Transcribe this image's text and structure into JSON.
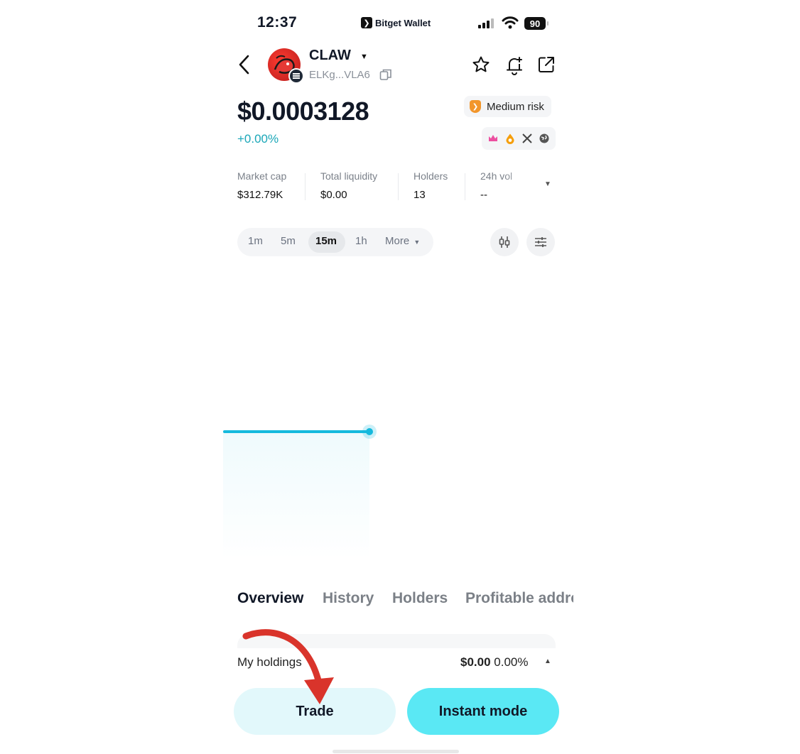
{
  "status_bar": {
    "time": "12:37",
    "app_name": "Bitget Wallet",
    "battery": "90"
  },
  "token": {
    "symbol": "CLAW",
    "address": "ELKg...VLA6",
    "price": "$0.0003128",
    "change": "+0.00%",
    "risk_label": "Medium risk",
    "change_color": "#1aa7b8"
  },
  "stats": [
    {
      "label": "Market cap",
      "value": "$312.79K"
    },
    {
      "label": "Total liquidity",
      "value": "$0.00"
    },
    {
      "label": "Holders",
      "value": "13"
    },
    {
      "label": "24h vol",
      "value": "--"
    }
  ],
  "intervals": {
    "items": [
      "1m",
      "5m",
      "15m",
      "1h"
    ],
    "active": "15m",
    "more_label": "More"
  },
  "icons": {
    "back": "back-arrow-icon",
    "favorite": "star-icon",
    "alert": "bell-plus-icon",
    "share": "share-icon",
    "copy": "copy-icon",
    "chart_type": "candlestick-icon",
    "settings": "sliders-icon"
  },
  "tabs": [
    "Overview",
    "History",
    "Holders",
    "Profitable addre"
  ],
  "holdings": {
    "label": "My holdings",
    "value": "$0.00",
    "percent": "0.00%"
  },
  "actions": {
    "trade": "Trade",
    "instant": "Instant mode"
  },
  "colors": {
    "accent": "#15b9dd",
    "instant_button": "#5ae8f4",
    "trade_button": "#e2f8fb",
    "annotation_arrow": "#d9342b"
  }
}
